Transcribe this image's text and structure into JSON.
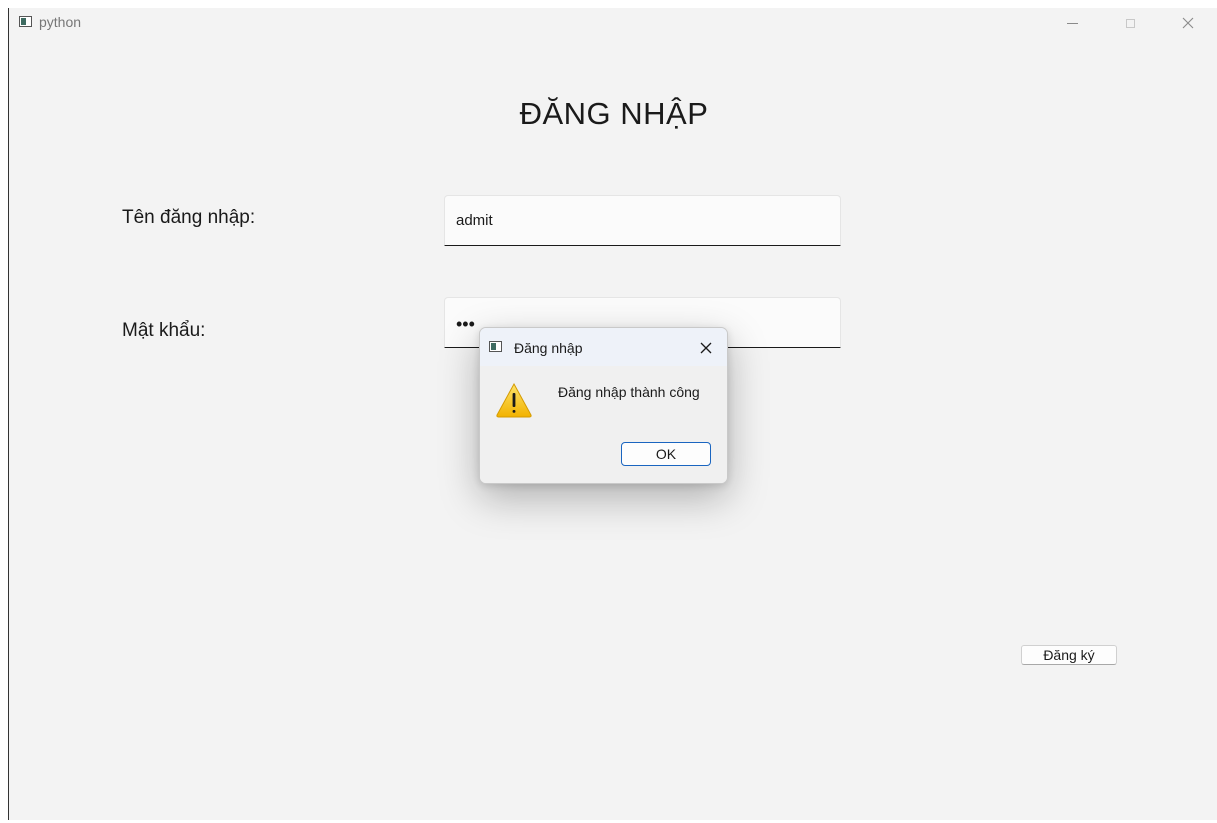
{
  "window": {
    "title": "python",
    "icon": "app-window-icon"
  },
  "login": {
    "heading": "ĐĂNG NHẬP",
    "username_label": "Tên đăng nhập:",
    "username_value": "admit",
    "password_label": "Mật khẩu:",
    "password_value": "•••",
    "register_label": "Đăng ký"
  },
  "dialog": {
    "title": "Đăng nhập",
    "icon": "warning-icon",
    "message": "Đăng nhập thành công",
    "ok_label": "OK"
  },
  "colors": {
    "window_bg": "#f3f3f3",
    "dialog_titlebar": "#eef2f9",
    "ok_border": "#1a65c0",
    "warning_fill": "#f7c21a"
  }
}
